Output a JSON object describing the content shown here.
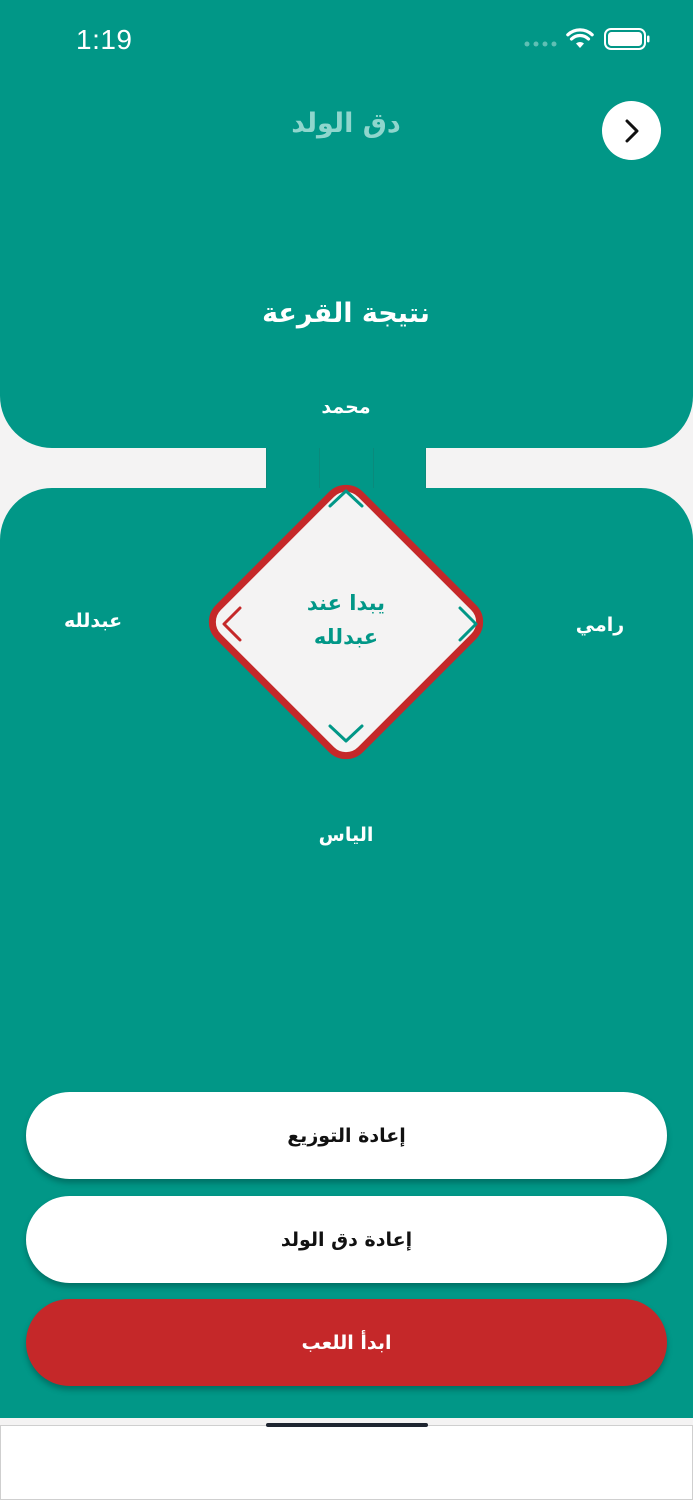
{
  "status_bar": {
    "time": "1:19"
  },
  "header": {
    "title": "دق الولد",
    "nav_icon": "chevron-right-icon"
  },
  "draw": {
    "section_title": "نتيجة القرعة",
    "players": {
      "top": "محمد",
      "left": "عبدلله",
      "right": "رامي",
      "bottom": "الياس"
    },
    "center_line1": "يبدا عند",
    "center_line2": "عبدلله"
  },
  "buttons": {
    "redistribute": "إعادة التوزيع",
    "reroll": "إعادة دق الولد",
    "start": "ابدأ اللعب"
  },
  "colors": {
    "primary": "#019787",
    "accent_red": "#c52829",
    "background": "#f4f3f3",
    "title_tint": "#8fd6cd"
  }
}
